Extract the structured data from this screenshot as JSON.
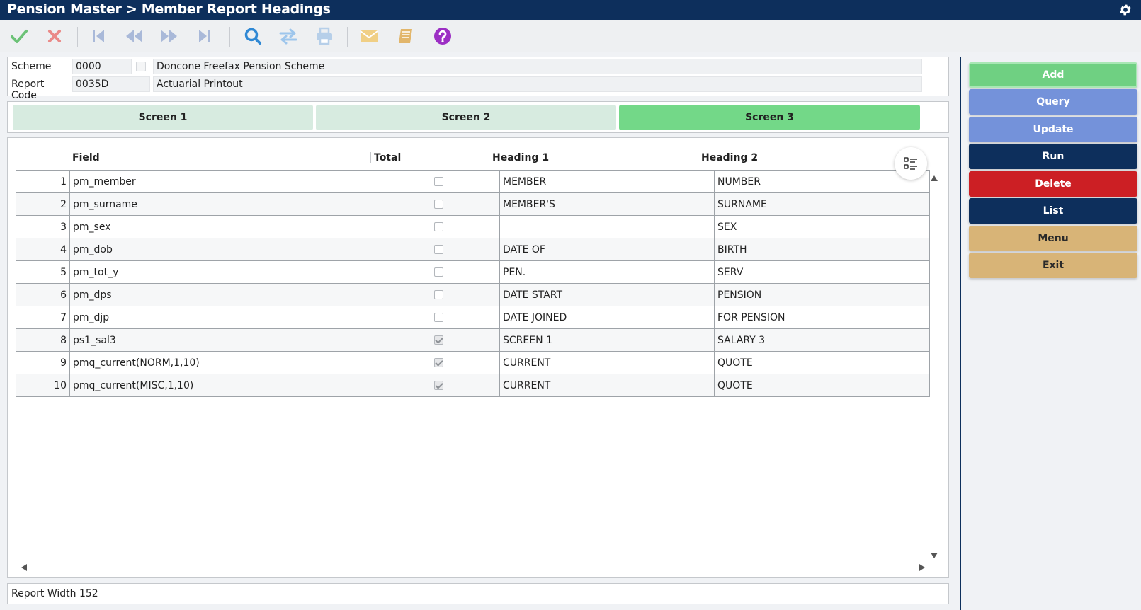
{
  "window": {
    "title": "Pension Master > Member Report Headings",
    "settings_icon": "gear-icon"
  },
  "toolbar": {
    "icons": [
      "check-icon",
      "cancel-icon",
      "first-record-icon",
      "previous-record-icon",
      "next-record-icon",
      "last-record-icon",
      "search-icon",
      "swap-icon",
      "print-icon",
      "email-icon",
      "notebook-icon",
      "help-icon"
    ]
  },
  "header": {
    "scheme_label": "Scheme",
    "scheme_code": "0000",
    "scheme_name": "Doncone Freefax Pension Scheme",
    "report_code_label": "Report Code",
    "report_code": "0035D",
    "report_name": "Actuarial Printout"
  },
  "tabs": [
    {
      "label": "Screen 1",
      "active": false
    },
    {
      "label": "Screen 2",
      "active": false
    },
    {
      "label": "Screen 3",
      "active": true
    }
  ],
  "grid": {
    "columns": [
      "Field",
      "Total",
      "Heading 1",
      "Heading 2"
    ],
    "rows": [
      {
        "num": "1",
        "field": "pm_member",
        "total": false,
        "heading1": "MEMBER",
        "heading2": "NUMBER"
      },
      {
        "num": "2",
        "field": "pm_surname",
        "total": false,
        "heading1": "MEMBER'S",
        "heading2": "SURNAME"
      },
      {
        "num": "3",
        "field": "pm_sex",
        "total": false,
        "heading1": "",
        "heading2": "SEX"
      },
      {
        "num": "4",
        "field": "pm_dob",
        "total": false,
        "heading1": "DATE OF",
        "heading2": "BIRTH"
      },
      {
        "num": "5",
        "field": "pm_tot_y",
        "total": false,
        "heading1": "PEN.",
        "heading2": "SERV"
      },
      {
        "num": "6",
        "field": "pm_dps",
        "total": false,
        "heading1": "DATE START",
        "heading2": "PENSION"
      },
      {
        "num": "7",
        "field": "pm_djp",
        "total": false,
        "heading1": "DATE JOINED",
        "heading2": "FOR PENSION"
      },
      {
        "num": "8",
        "field": "ps1_sal3",
        "total": true,
        "heading1": "SCREEN 1",
        "heading2": "SALARY 3"
      },
      {
        "num": "9",
        "field": "pmq_current(NORM,1,10)",
        "total": true,
        "heading1": "CURRENT",
        "heading2": "QUOTE"
      },
      {
        "num": "10",
        "field": "pmq_current(MISC,1,10)",
        "total": true,
        "heading1": "CURRENT",
        "heading2": "QUOTE"
      }
    ]
  },
  "footer": {
    "text": "Report Width 152"
  },
  "actions": [
    {
      "label": "Add",
      "color": "#6fd082"
    },
    {
      "label": "Query",
      "color": "#7492da"
    },
    {
      "label": "Update",
      "color": "#7492da"
    },
    {
      "label": "Run",
      "color": "#0d2f5c"
    },
    {
      "label": "Delete",
      "color": "#cc1f24"
    },
    {
      "label": "List",
      "color": "#0d2f5c"
    },
    {
      "label": "Menu",
      "color": "#d8b477"
    },
    {
      "label": "Exit",
      "color": "#d8b477"
    }
  ],
  "colors": {
    "titlebar": "#0d2f5c",
    "tab_inactive": "#d7ebe0",
    "tab_active": "#73d888"
  }
}
